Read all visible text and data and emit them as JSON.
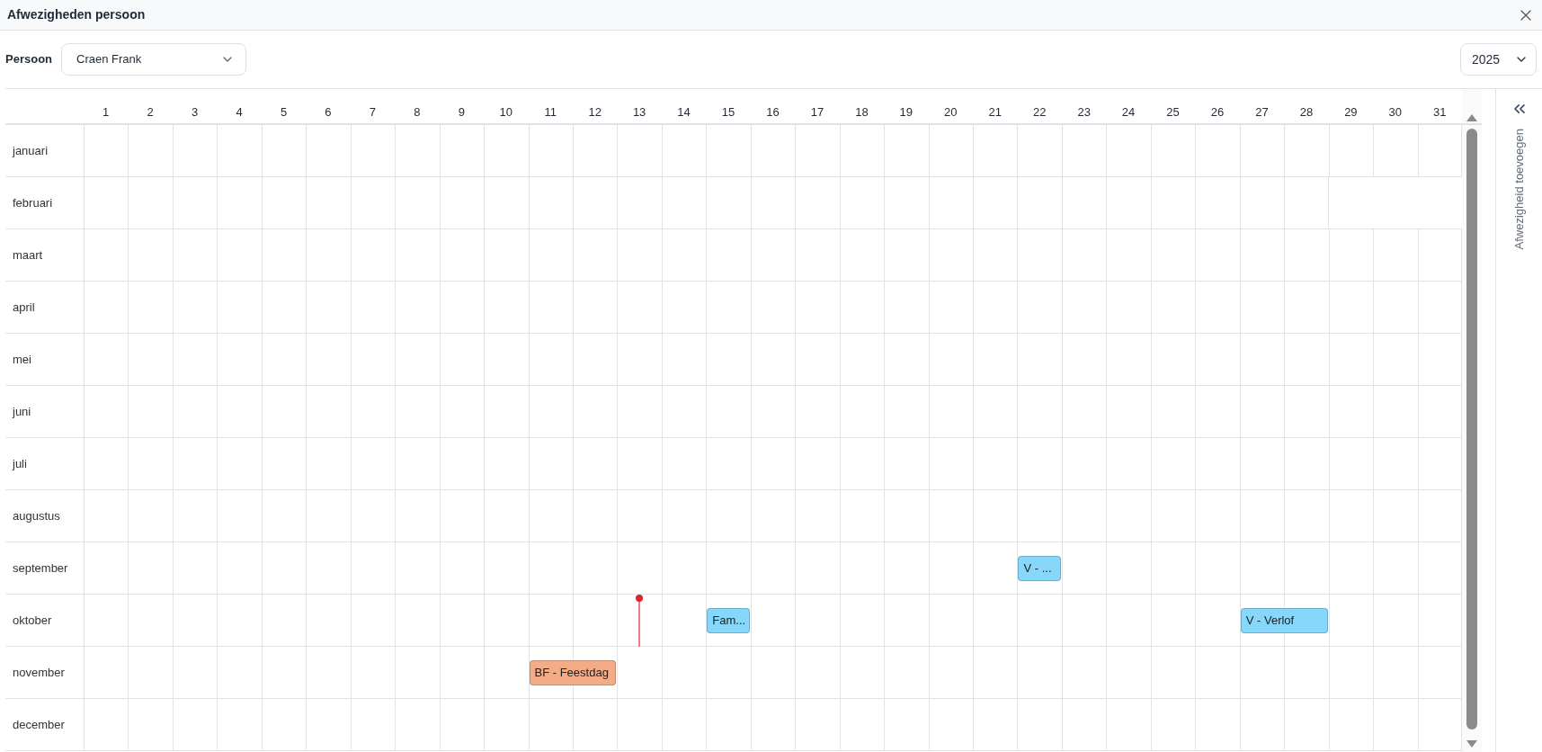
{
  "window": {
    "title": "Afwezigheden persoon"
  },
  "person": {
    "label": "Persoon",
    "value": "Craen Frank"
  },
  "year": {
    "value": "2025"
  },
  "days": [
    "1",
    "2",
    "3",
    "4",
    "5",
    "6",
    "7",
    "8",
    "9",
    "10",
    "11",
    "12",
    "13",
    "14",
    "15",
    "16",
    "17",
    "18",
    "19",
    "20",
    "21",
    "22",
    "23",
    "24",
    "25",
    "26",
    "27",
    "28",
    "29",
    "30",
    "31"
  ],
  "months": [
    {
      "name": "januari",
      "kind": "full"
    },
    {
      "name": "februari",
      "kind": "short"
    },
    {
      "name": "maart",
      "kind": "full"
    },
    {
      "name": "april",
      "kind": "full"
    },
    {
      "name": "mei",
      "kind": "full"
    },
    {
      "name": "juni",
      "kind": "full"
    },
    {
      "name": "juli",
      "kind": "full"
    },
    {
      "name": "augustus",
      "kind": "full"
    },
    {
      "name": "september",
      "kind": "full",
      "cells": [
        {
          "kind": "day"
        },
        {
          "kind": "day"
        },
        {
          "kind": "day"
        },
        {
          "kind": "day"
        },
        {
          "kind": "day"
        },
        {
          "kind": "day"
        },
        {
          "kind": "day"
        },
        {
          "kind": "day"
        },
        {
          "kind": "day"
        },
        {
          "kind": "day"
        },
        {
          "kind": "day"
        },
        {
          "kind": "day"
        },
        {
          "kind": "day"
        },
        {
          "kind": "day"
        },
        {
          "kind": "day"
        },
        {
          "kind": "day"
        },
        {
          "kind": "day"
        },
        {
          "kind": "day"
        },
        {
          "kind": "day"
        },
        {
          "kind": "day"
        },
        {
          "kind": "day"
        },
        {
          "kind": "event",
          "label": "V - ...",
          "color": "#87d7fb"
        },
        {
          "kind": "day"
        },
        {
          "kind": "day"
        },
        {
          "kind": "day"
        },
        {
          "kind": "day"
        },
        {
          "kind": "day"
        },
        {
          "kind": "day"
        },
        {
          "kind": "day"
        },
        {
          "kind": "day"
        },
        {
          "kind": "day"
        }
      ]
    },
    {
      "name": "oktober",
      "kind": "full",
      "cells": [
        {
          "kind": "day"
        },
        {
          "kind": "day"
        },
        {
          "kind": "day"
        },
        {
          "kind": "day"
        },
        {
          "kind": "day"
        },
        {
          "kind": "day"
        },
        {
          "kind": "day"
        },
        {
          "kind": "day"
        },
        {
          "kind": "day"
        },
        {
          "kind": "day"
        },
        {
          "kind": "day"
        },
        {
          "kind": "day"
        },
        {
          "kind": "today"
        },
        {
          "kind": "day"
        },
        {
          "kind": "event",
          "label": "Fam...",
          "color": "#87d7fb"
        },
        {
          "kind": "day"
        },
        {
          "kind": "day"
        },
        {
          "kind": "day"
        },
        {
          "kind": "day"
        },
        {
          "kind": "day"
        },
        {
          "kind": "day"
        },
        {
          "kind": "day"
        },
        {
          "kind": "day"
        },
        {
          "kind": "day"
        },
        {
          "kind": "day"
        },
        {
          "kind": "day"
        },
        {
          "kind": "event",
          "label": "V - Verlof",
          "color": "#87d7fb"
        },
        {
          "kind": "span"
        },
        {
          "kind": "day"
        },
        {
          "kind": "day"
        },
        {
          "kind": "day"
        }
      ]
    },
    {
      "name": "november",
      "kind": "full",
      "cells": [
        {
          "kind": "day"
        },
        {
          "kind": "day"
        },
        {
          "kind": "day"
        },
        {
          "kind": "day"
        },
        {
          "kind": "day"
        },
        {
          "kind": "day"
        },
        {
          "kind": "day"
        },
        {
          "kind": "day"
        },
        {
          "kind": "day"
        },
        {
          "kind": "day"
        },
        {
          "kind": "event",
          "label": "BF - Feestdag",
          "color": "#f4ac87"
        },
        {
          "kind": "span"
        },
        {
          "kind": "day"
        },
        {
          "kind": "day"
        },
        {
          "kind": "day"
        },
        {
          "kind": "day"
        },
        {
          "kind": "day"
        },
        {
          "kind": "day"
        },
        {
          "kind": "day"
        },
        {
          "kind": "day"
        },
        {
          "kind": "day"
        },
        {
          "kind": "day"
        },
        {
          "kind": "day"
        },
        {
          "kind": "day"
        },
        {
          "kind": "day"
        },
        {
          "kind": "day"
        },
        {
          "kind": "day"
        },
        {
          "kind": "day"
        },
        {
          "kind": "day"
        },
        {
          "kind": "day"
        },
        {
          "kind": "day"
        }
      ]
    },
    {
      "name": "december",
      "kind": "full"
    }
  ],
  "side_panel": {
    "label": "Afwezigheid toevoegen"
  }
}
